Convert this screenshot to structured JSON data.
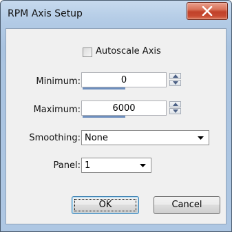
{
  "window": {
    "title": "RPM Axis Setup"
  },
  "titlebar": {
    "close_icon": "close-x-icon"
  },
  "form": {
    "autoscale": {
      "label": "Autoscale Axis",
      "checked": false
    },
    "minimum": {
      "label": "Minimum:",
      "value": "0"
    },
    "maximum": {
      "label": "Maximum:",
      "value": "6000"
    },
    "smoothing": {
      "label": "Smoothing:",
      "value": "None"
    },
    "panel": {
      "label": "Panel:",
      "value": "1"
    }
  },
  "buttons": {
    "ok_label": "OK",
    "cancel_label": "Cancel"
  },
  "colors": {
    "close_button": "#c7442b",
    "frame": "#aec7e3",
    "client": "#f0f0f0",
    "default_button_border": "#3c7fb1"
  }
}
